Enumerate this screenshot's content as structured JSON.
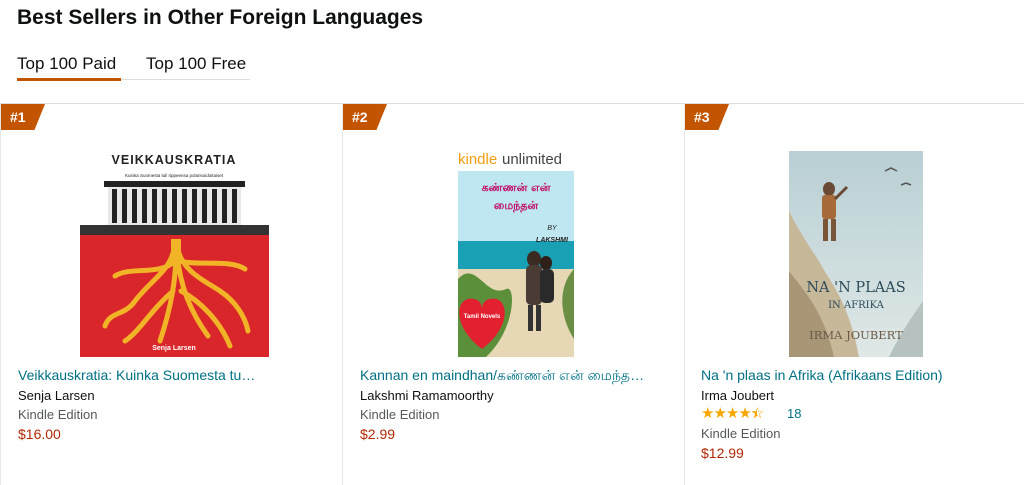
{
  "page": {
    "title": "Best Sellers in Other Foreign Languages"
  },
  "tabs": [
    {
      "label": "Top 100 Paid"
    },
    {
      "label": "Top 100 Free"
    }
  ],
  "items": [
    {
      "rank": "#1",
      "cover": {
        "heading": "VEIKKAUSKRATIA",
        "subtitle": "Kuinka Suomesta tuli rippeensa polarisoidoitaiset",
        "author": "Senja Larsen"
      },
      "title": "Veikkauskratia: Kuinka Suomesta tuli…",
      "author": "Senja Larsen",
      "format": "Kindle Edition",
      "price": "$16.00"
    },
    {
      "rank": "#2",
      "cover": {
        "badge_kindle": "kindle",
        "badge_unlimited": "unlimited",
        "title_line1": "கண்ணன் என்",
        "title_line2": "மைந்தன்",
        "by": "BY",
        "author": "LAKSHMI",
        "heart_label": "Tamil Novels"
      },
      "title": "Kannan en maindhan/கண்ணன் என் மைந்தன்…",
      "author": "Lakshmi Ramamoorthy",
      "format": "Kindle Edition",
      "price": "$2.99"
    },
    {
      "rank": "#3",
      "cover": {
        "title_line1": "NA 'N PLAAS",
        "title_line2": "IN AFRIKA",
        "author": "IRMA JOUBERT"
      },
      "title": "Na 'n plaas in Afrika (Afrikaans Edition)",
      "author": "Irma Joubert",
      "rating": 4.5,
      "rating_count": "18",
      "format": "Kindle Edition",
      "price": "$12.99"
    }
  ]
}
